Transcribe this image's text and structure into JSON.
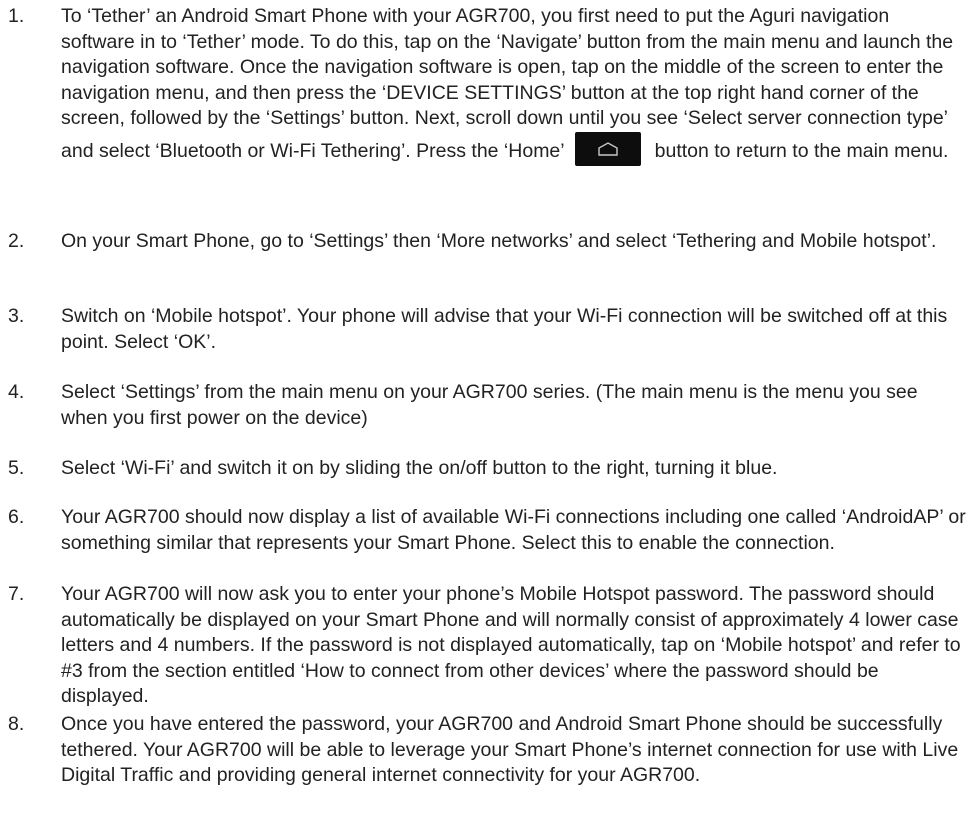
{
  "steps": [
    {
      "number": "1.",
      "text_before": "To ‘Tether’ an Android Smart Phone with your AGR700, you first need to put the Aguri navigation software in to ‘Tether’ mode. To do this, tap on the ‘Navigate’ button from the main menu and launch the navigation software. Once the navigation software is open, tap on the middle of the screen to enter the navigation menu, and then press the ‘DEVICE SETTINGS’ button at the top right hand corner of the screen, followed by the ‘Settings’ button. Next, scroll down until you see ‘Select server connection type’ and select ‘Bluetooth or Wi-Fi Tethering’. Press the ‘Home’",
      "icon": "home-icon",
      "text_after": "button to return to the main menu."
    },
    {
      "number": "2.",
      "text": "On your Smart Phone, go to ‘Settings’ then ‘More networks’ and select ‘Tethering and Mobile hotspot’."
    },
    {
      "number": "3.",
      "text": "Switch on ‘Mobile hotspot’. Your phone will advise that your Wi-Fi connection will be switched off at this point. Select ‘OK’."
    },
    {
      "number": "4.",
      "text": "Select ‘Settings’ from the main menu on your AGR700 series. (The main menu is the menu you see when you first power on the device)"
    },
    {
      "number": "5.",
      "text": "Select ‘Wi-Fi’ and switch it on by sliding the on/off button to the right, turning it blue."
    },
    {
      "number": "6.",
      "text": "Your AGR700 should now display a list of available Wi-Fi connections including one called ‘AndroidAP’ or something similar that represents your Smart Phone. Select this to enable the connection."
    },
    {
      "number": "7.",
      "text": "Your AGR700 will now ask you to enter your phone’s Mobile Hotspot password. The password should automatically be displayed on your Smart Phone and will normally consist of approximately 4 lower case letters and 4 numbers. If the password is not displayed automatically, tap on ‘Mobile hotspot’ and refer to #3 from the section entitled ‘How to connect from other devices’ where the password should be displayed."
    },
    {
      "number": "8.",
      "text": "Once you have entered the password, your AGR700 and Android Smart Phone should be successfully tethered. Your AGR700 will be able to leverage your Smart Phone’s internet connection for use with Live Digital Traffic and providing general internet connectivity for your AGR700."
    }
  ]
}
